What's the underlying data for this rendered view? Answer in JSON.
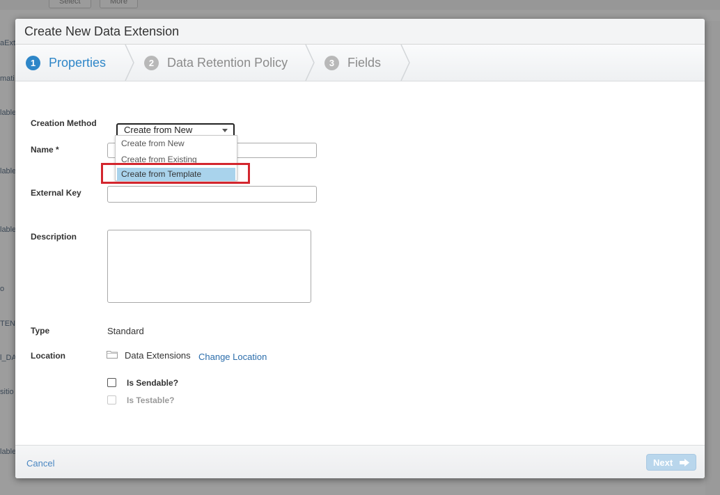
{
  "background": {
    "toolbar_buttons": [
      "Select",
      "More"
    ],
    "row_fragments": [
      "aExt",
      "mati",
      "lable",
      "lable",
      "lable",
      "o",
      "TEN",
      "l_DA",
      "sitio",
      "lable"
    ]
  },
  "modal": {
    "title": "Create New Data Extension",
    "steps": [
      {
        "num": "1",
        "label": "Properties"
      },
      {
        "num": "2",
        "label": "Data Retention Policy"
      },
      {
        "num": "3",
        "label": "Fields"
      }
    ],
    "form": {
      "creation_method_label": "Creation Method",
      "creation_method_value": "Create from New",
      "creation_method_options": [
        "Create from New",
        "Create from Existing",
        "Create from Template"
      ],
      "name_label": "Name *",
      "external_key_label": "External Key",
      "description_label": "Description",
      "type_label": "Type",
      "type_value": "Standard",
      "location_label": "Location",
      "location_value": "Data Extensions",
      "change_location": "Change Location",
      "is_sendable": "Is Sendable?",
      "is_testable": "Is Testable?"
    },
    "footer": {
      "cancel": "Cancel",
      "next": "Next"
    }
  },
  "colors": {
    "accent": "#2e86c8",
    "highlight": "#d3262e",
    "selected_option": "#a9d3ec"
  }
}
